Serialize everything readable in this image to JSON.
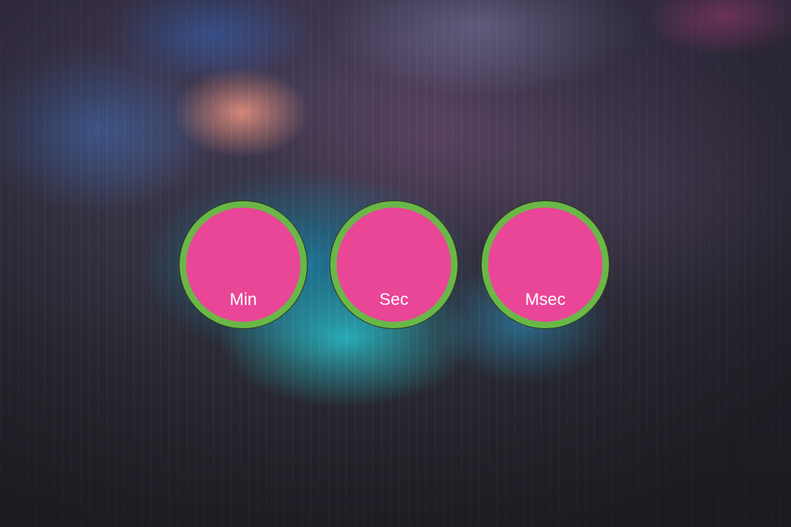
{
  "background": {
    "name": "blurred-bokeh-background"
  },
  "colors": {
    "dial_fill": "#e94697",
    "dial_ring": "#69b847",
    "label_text": "#ffffff"
  },
  "timer": {
    "dials": [
      {
        "id": "min",
        "label": "Min",
        "value": ""
      },
      {
        "id": "sec",
        "label": "Sec",
        "value": ""
      },
      {
        "id": "msec",
        "label": "Msec",
        "value": ""
      }
    ]
  }
}
